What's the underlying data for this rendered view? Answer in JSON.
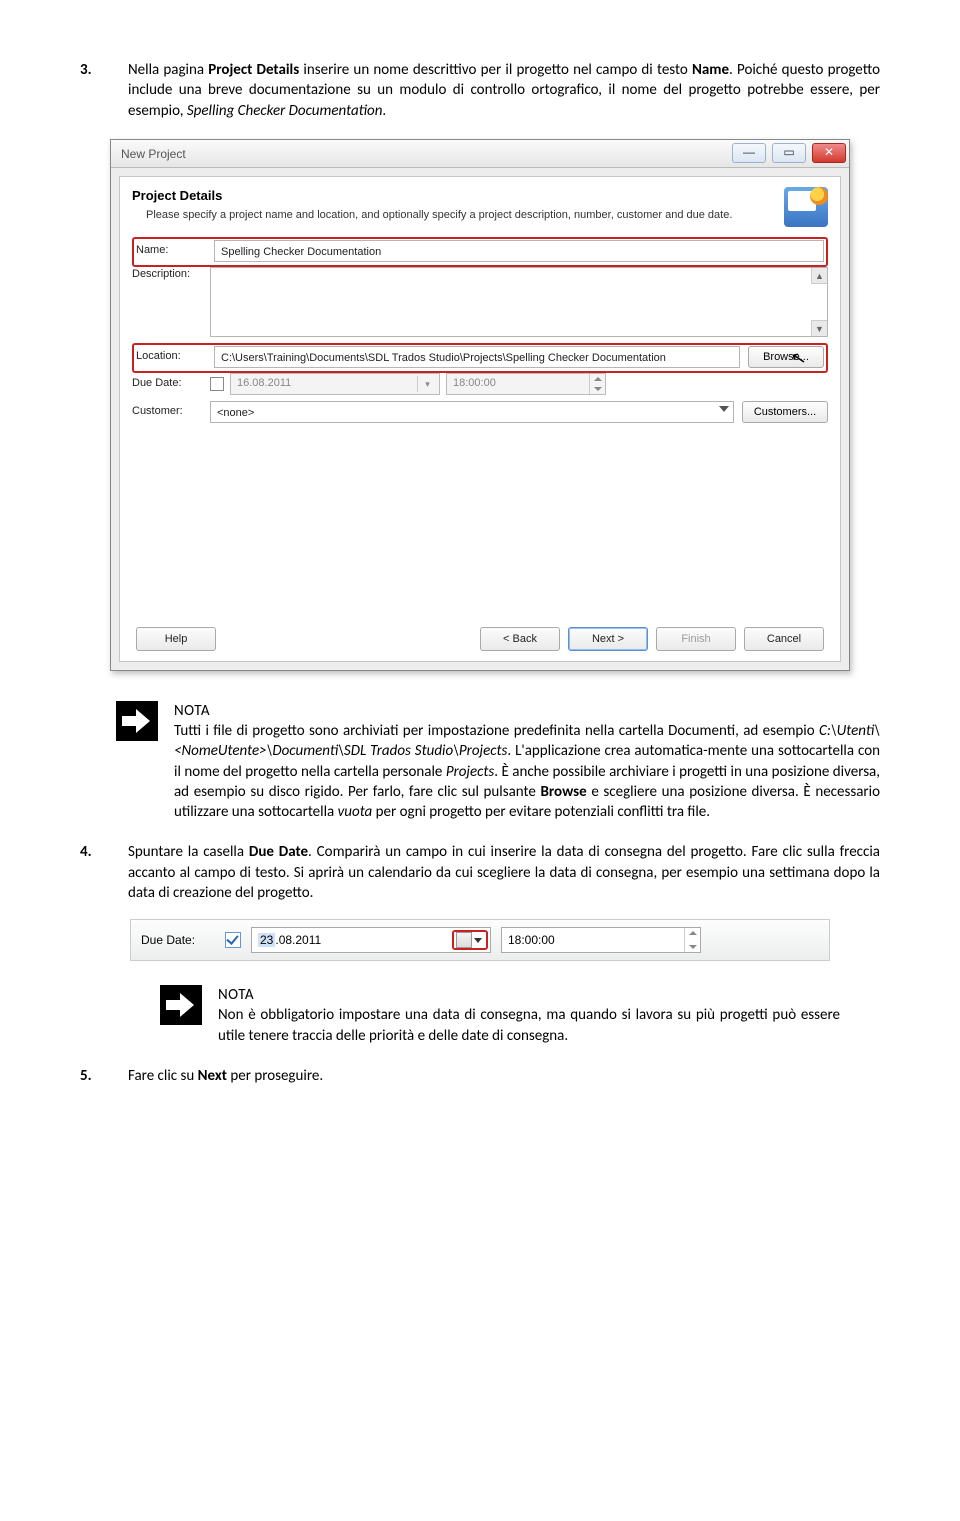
{
  "step3": {
    "num": "3.",
    "before": "Nella pagina ",
    "boldA": "Project Details",
    "mid": " inserire un nome descrittivo per il progetto nel campo di testo ",
    "boldB": "Name",
    "after1": ". Poiché questo progetto include una breve documentazione su un modulo di controllo ortografico, il nome del progetto potrebbe essere, per esempio, ",
    "italic": "Spelling Checker Documentation",
    "after2": "."
  },
  "dialog": {
    "windowTitle": "New Project",
    "sectionTitle": "Project Details",
    "sectionDesc": "Please specify a project name and location, and optionally specify a project description, number, customer and due date.",
    "labels": {
      "name": "Name:",
      "description": "Description:",
      "location": "Location:",
      "dueDate": "Due Date:",
      "customer": "Customer:"
    },
    "values": {
      "name": "Spelling Checker Documentation",
      "location": "C:\\Users\\Training\\Documents\\SDL Trados Studio\\Projects\\Spelling Checker Documentation",
      "date": "16.08.2011",
      "time": "18:00:00",
      "customer": "<none>"
    },
    "buttons": {
      "browse": "Browse...",
      "customers": "Customers...",
      "help": "Help",
      "back": "< Back",
      "next": "Next >",
      "finish": "Finish",
      "cancel": "Cancel"
    }
  },
  "nota1": {
    "title": "NOTA",
    "p1a": "Tutti i file di progetto sono archiviati per impostazione predefinita nella cartella Documenti, ad esempio ",
    "p1italic": "C:\\Utenti\\<NomeUtente>\\Documenti\\SDL Trados Studio\\Projects",
    "p1b": ". L'applicazione crea automatica-mente una sottocartella con il nome del progetto nella cartella personale ",
    "p1italic2": "Projects",
    "p1c": ". È anche possibile archiviare i progetti in una posizione diversa, ad esempio su disco rigido. Per farlo, fare clic sul pulsante ",
    "bold1": "Browse",
    "p1d": " e scegliere una posizione diversa. È necessario utilizzare una sottocartella ",
    "italic3": "vuota",
    "p1e": " per ogni progetto per evitare potenziali conflitti tra file."
  },
  "step4": {
    "num": "4.",
    "a": "Spuntare la casella ",
    "bold": "Due Date",
    "b": ". Comparirà un campo in cui inserire la data di consegna del progetto. Fare clic sulla freccia accanto al campo di testo. Si aprirà un calendario da cui scegliere la data di consegna, per esempio una settimana dopo la data di creazione del progetto."
  },
  "duedate_strip": {
    "label": "Due Date:",
    "day_sel": "23",
    "rest": ".08.2011",
    "time": "18:00:00"
  },
  "nota2": {
    "title": "NOTA",
    "text": "Non è obbligatorio impostare una data di consegna, ma quando si lavora su più progetti può essere utile tenere traccia delle priorità e delle date di consegna."
  },
  "step5": {
    "num": "5.",
    "a": "Fare clic su ",
    "bold": "Next",
    "b": " per proseguire."
  }
}
